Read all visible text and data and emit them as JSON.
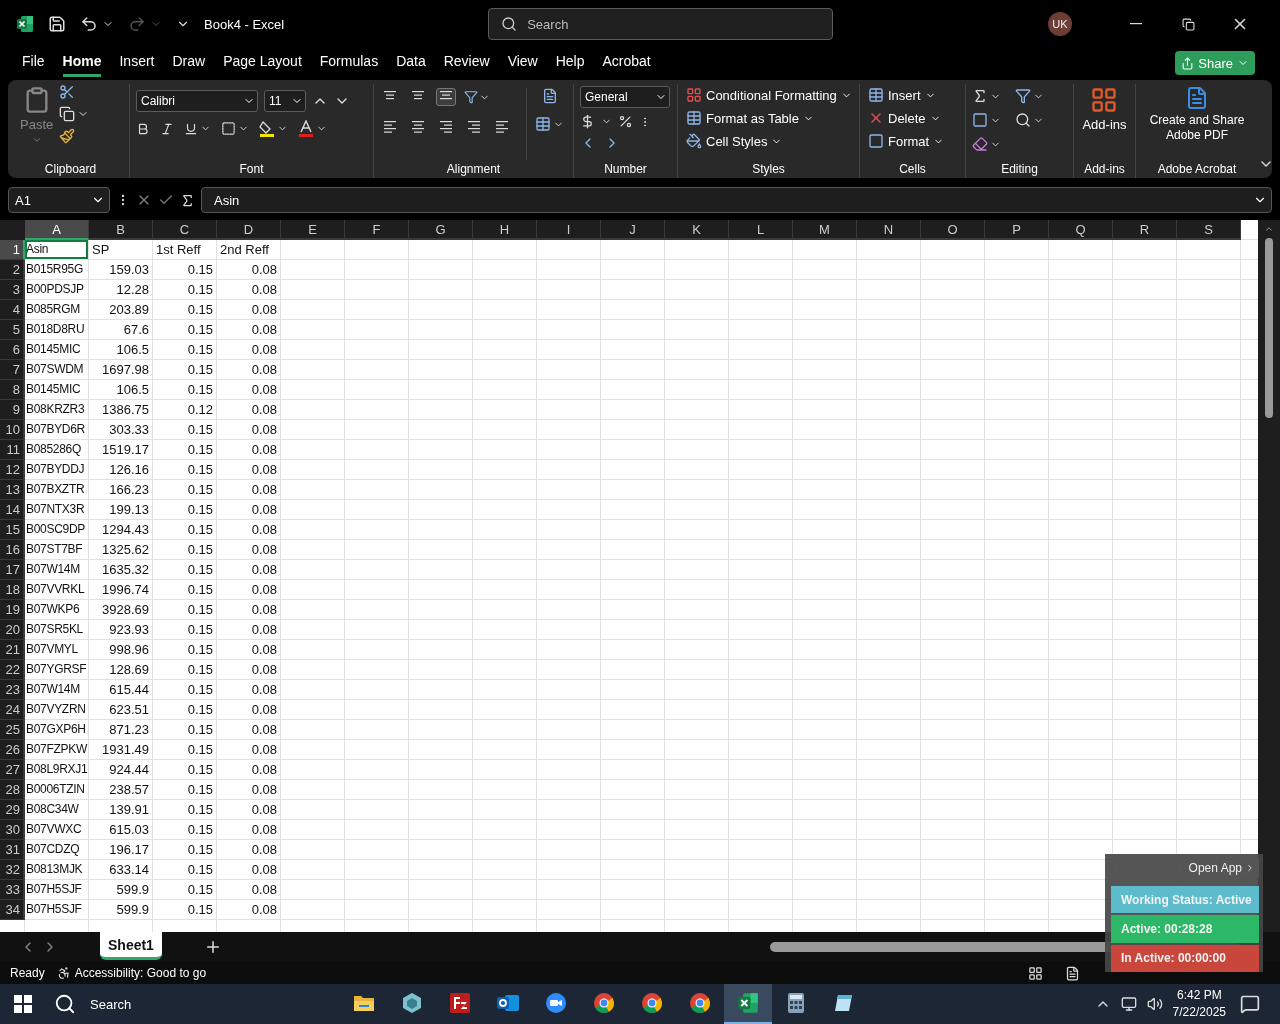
{
  "title_bar": {
    "title": "Book4  -  Excel",
    "search_placeholder": "Search",
    "avatar": "UK"
  },
  "menu_tabs": [
    {
      "label": "File",
      "selected": false
    },
    {
      "label": "Home",
      "selected": true
    },
    {
      "label": "Insert",
      "selected": false
    },
    {
      "label": "Draw",
      "selected": false
    },
    {
      "label": "Page Layout",
      "selected": false
    },
    {
      "label": "Formulas",
      "selected": false
    },
    {
      "label": "Data",
      "selected": false
    },
    {
      "label": "Review",
      "selected": false
    },
    {
      "label": "View",
      "selected": false
    },
    {
      "label": "Help",
      "selected": false
    },
    {
      "label": "Acrobat",
      "selected": false
    }
  ],
  "share": "Share",
  "ribbon": {
    "clipboard": {
      "paste": "Paste",
      "disabled": true,
      "label": "Clipboard"
    },
    "font": {
      "name": "Calibri",
      "size": "11",
      "label": "Font"
    },
    "alignment": {
      "label": "Alignment"
    },
    "number": {
      "format": "General",
      "label": "Number"
    },
    "styles": {
      "items": [
        "Conditional Formatting",
        "Format as Table",
        "Cell Styles"
      ],
      "label": "Styles"
    },
    "cells": {
      "items": [
        "Insert",
        "Delete",
        "Format"
      ],
      "label": "Cells"
    },
    "editing": {
      "label": "Editing"
    },
    "addins": {
      "button": "Add-ins",
      "label": "Add-ins"
    },
    "acrobat": {
      "button": "Create and Share Adobe PDF",
      "label": "Adobe Acrobat"
    }
  },
  "formula_bar": {
    "name_box": "A1",
    "content": "Asin"
  },
  "sheet": {
    "columns": [
      {
        "label": "A",
        "selected": true
      },
      {
        "label": "B",
        "selected": false
      },
      {
        "label": "C",
        "selected": false
      },
      {
        "label": "D",
        "selected": false
      },
      {
        "label": "E",
        "selected": false
      },
      {
        "label": "F",
        "selected": false
      },
      {
        "label": "G",
        "selected": false
      },
      {
        "label": "H",
        "selected": false
      },
      {
        "label": "I",
        "selected": false
      },
      {
        "label": "J",
        "selected": false
      },
      {
        "label": "K",
        "selected": false
      },
      {
        "label": "L",
        "selected": false
      },
      {
        "label": "M",
        "selected": false
      },
      {
        "label": "N",
        "selected": false
      },
      {
        "label": "O",
        "selected": false
      },
      {
        "label": "P",
        "selected": false
      },
      {
        "label": "Q",
        "selected": false
      },
      {
        "label": "R",
        "selected": false
      },
      {
        "label": "S",
        "selected": false
      }
    ],
    "rows": [
      {
        "number": "1",
        "selected": true,
        "cells": [
          "Asin",
          "SP",
          "1st Reff",
          "2nd Reff"
        ]
      },
      {
        "number": "2",
        "selected": false,
        "cells": [
          "B015R95G",
          "159.03",
          "0.15",
          "0.08"
        ]
      },
      {
        "number": "3",
        "selected": false,
        "cells": [
          "B00PDSJP",
          "12.28",
          "0.15",
          "0.08"
        ]
      },
      {
        "number": "4",
        "selected": false,
        "cells": [
          "B085RGM",
          "203.89",
          "0.15",
          "0.08"
        ]
      },
      {
        "number": "5",
        "selected": false,
        "cells": [
          "B018D8RU",
          "67.6",
          "0.15",
          "0.08"
        ]
      },
      {
        "number": "6",
        "selected": false,
        "cells": [
          "B0145MIC",
          "106.5",
          "0.15",
          "0.08"
        ]
      },
      {
        "number": "7",
        "selected": false,
        "cells": [
          "B07SWDM",
          "1697.98",
          "0.15",
          "0.08"
        ]
      },
      {
        "number": "8",
        "selected": false,
        "cells": [
          "B0145MIC",
          "106.5",
          "0.15",
          "0.08"
        ]
      },
      {
        "number": "9",
        "selected": false,
        "cells": [
          "B08KRZR3",
          "1386.75",
          "0.12",
          "0.08"
        ]
      },
      {
        "number": "10",
        "selected": false,
        "cells": [
          "B07BYD6R",
          "303.33",
          "0.15",
          "0.08"
        ]
      },
      {
        "number": "11",
        "selected": false,
        "cells": [
          "B085286Q",
          "1519.17",
          "0.15",
          "0.08"
        ]
      },
      {
        "number": "12",
        "selected": false,
        "cells": [
          "B07BYDDJ",
          "126.16",
          "0.15",
          "0.08"
        ]
      },
      {
        "number": "13",
        "selected": false,
        "cells": [
          "B07BXZTR",
          "166.23",
          "0.15",
          "0.08"
        ]
      },
      {
        "number": "14",
        "selected": false,
        "cells": [
          "B07NTX3R",
          "199.13",
          "0.15",
          "0.08"
        ]
      },
      {
        "number": "15",
        "selected": false,
        "cells": [
          "B00SC9DP",
          "1294.43",
          "0.15",
          "0.08"
        ]
      },
      {
        "number": "16",
        "selected": false,
        "cells": [
          "B07ST7BF",
          "1325.62",
          "0.15",
          "0.08"
        ]
      },
      {
        "number": "17",
        "selected": false,
        "cells": [
          "B07W14M",
          "1635.32",
          "0.15",
          "0.08"
        ]
      },
      {
        "number": "18",
        "selected": false,
        "cells": [
          "B07VVRKL",
          "1996.74",
          "0.15",
          "0.08"
        ]
      },
      {
        "number": "19",
        "selected": false,
        "cells": [
          "B07WKP6",
          "3928.69",
          "0.15",
          "0.08"
        ]
      },
      {
        "number": "20",
        "selected": false,
        "cells": [
          "B07SR5KL",
          "923.93",
          "0.15",
          "0.08"
        ]
      },
      {
        "number": "21",
        "selected": false,
        "cells": [
          "B07VMYL",
          "998.96",
          "0.15",
          "0.08"
        ]
      },
      {
        "number": "22",
        "selected": false,
        "cells": [
          "B07YGRSF",
          "128.69",
          "0.15",
          "0.08"
        ]
      },
      {
        "number": "23",
        "selected": false,
        "cells": [
          "B07W14M",
          "615.44",
          "0.15",
          "0.08"
        ]
      },
      {
        "number": "24",
        "selected": false,
        "cells": [
          "B07VYZRN",
          "623.51",
          "0.15",
          "0.08"
        ]
      },
      {
        "number": "25",
        "selected": false,
        "cells": [
          "B07GXP6H",
          "871.23",
          "0.15",
          "0.08"
        ]
      },
      {
        "number": "26",
        "selected": false,
        "cells": [
          "B07FZPKW",
          "1931.49",
          "0.15",
          "0.08"
        ]
      },
      {
        "number": "27",
        "selected": false,
        "cells": [
          "B08L9RXJ1",
          "924.44",
          "0.15",
          "0.08"
        ]
      },
      {
        "number": "28",
        "selected": false,
        "cells": [
          "B0006TZIN",
          "238.57",
          "0.15",
          "0.08"
        ]
      },
      {
        "number": "29",
        "selected": false,
        "cells": [
          "B08C34W",
          "139.91",
          "0.15",
          "0.08"
        ]
      },
      {
        "number": "30",
        "selected": false,
        "cells": [
          "B07VWXC",
          "615.03",
          "0.15",
          "0.08"
        ]
      },
      {
        "number": "31",
        "selected": false,
        "cells": [
          "B07CDZQ",
          "196.17",
          "0.15",
          "0.08"
        ]
      },
      {
        "number": "32",
        "selected": false,
        "cells": [
          "B0813MJK",
          "633.14",
          "0.15",
          "0.08"
        ]
      },
      {
        "number": "33",
        "selected": false,
        "cells": [
          "B07H5SJF",
          "599.9",
          "0.15",
          "0.08"
        ]
      },
      {
        "number": "34",
        "selected": false,
        "cells": [
          "B07H5SJF",
          "599.9",
          "0.15",
          "0.08"
        ]
      }
    ]
  },
  "sheet_tabs": [
    {
      "label": "Sheet1",
      "selected": true
    }
  ],
  "status_bar": {
    "ready": "Ready",
    "accessibility": "Accessibility: Good to go"
  },
  "tracker": {
    "open_app": "Open App",
    "statuses": [
      {
        "text": "Working Status: Active",
        "color": "#5cbccb"
      },
      {
        "text": "Active: 00:28:28",
        "color": "#2cb866"
      },
      {
        "text": "In Active: 00:00:00",
        "color": "#c8463c"
      }
    ]
  },
  "taskbar": {
    "search": "Search",
    "time": "6:42 PM",
    "date": "7/22/2025",
    "apps": [
      {
        "kind": "explorer",
        "selected": false
      },
      {
        "kind": "cube",
        "selected": false
      },
      {
        "kind": "filezilla",
        "selected": false
      },
      {
        "kind": "outlook",
        "selected": false
      },
      {
        "kind": "zoom",
        "selected": false
      },
      {
        "kind": "chrome",
        "selected": false
      },
      {
        "kind": "chrome",
        "selected": false
      },
      {
        "kind": "chrome",
        "selected": false
      },
      {
        "kind": "excel",
        "selected": true
      },
      {
        "kind": "calculator",
        "selected": false
      },
      {
        "kind": "notepad",
        "selected": false
      }
    ]
  }
}
